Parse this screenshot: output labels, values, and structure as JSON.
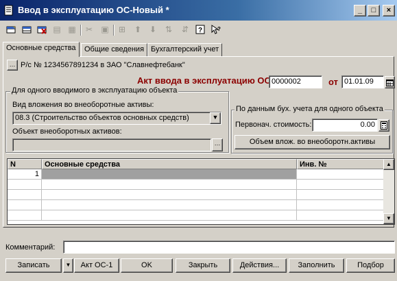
{
  "window": {
    "title": "Ввод в эксплуатацию ОС-Новый *",
    "minimize": "_",
    "maximize": "□",
    "close": "×"
  },
  "toolbar": {
    "icons": [
      "add-row-icon",
      "copy-row-icon",
      "delete-row-icon",
      "edit-row-icon",
      "end-edit-icon",
      "cut-icon",
      "paste-icon",
      "insert-group-icon",
      "move-up-icon",
      "move-down-icon",
      "sort-asc-icon",
      "sort-desc-icon",
      "help-icon",
      "context-help-icon"
    ]
  },
  "tabs": [
    {
      "label": "Основные средства",
      "active": true
    },
    {
      "label": "Общие сведения",
      "active": false
    },
    {
      "label": "Бухгалтерский учет",
      "active": false
    }
  ],
  "form": {
    "bank_account": "Р/с № 1234567891234 в ЗАО \"Славнефтебанк\"",
    "doc_title": "Акт ввода в эксплуатацию ОС №",
    "doc_number": "0000002",
    "date_label": "от",
    "doc_date": "01.01.09",
    "group_object_title": "Для одного вводимого в эксплуатацию объекта",
    "investment_type_label": "Вид вложения во внеоборотные активы:",
    "investment_type_value": "08.3 (Строительство объектов основных средств)",
    "asset_object_label": "Объект внеоборотных активов:",
    "asset_object_value": "",
    "group_accounting_title": "По данным бух. учета для одного объекта",
    "initial_cost_label": "Первонач. стоимость:",
    "initial_cost_value": "0.00",
    "volume_button": "Объем влож. во внеоборотн.активы"
  },
  "grid": {
    "columns": [
      "N",
      "Основные средства",
      "Инв. №"
    ],
    "rows": [
      {
        "n": "1",
        "asset": "",
        "inv": ""
      }
    ]
  },
  "comment": {
    "label": "Комментарий:",
    "value": ""
  },
  "buttons": {
    "save": "Записать",
    "act": "Акт ОС-1",
    "ok": "OK",
    "close": "Закрыть",
    "actions": "Действия...",
    "fill": "Заполнить",
    "select": "Подбор"
  },
  "colors": {
    "title_gradient_start": "#0a246a",
    "doc_title": "#8b0000",
    "selected_cell": "#a0a0a0"
  }
}
